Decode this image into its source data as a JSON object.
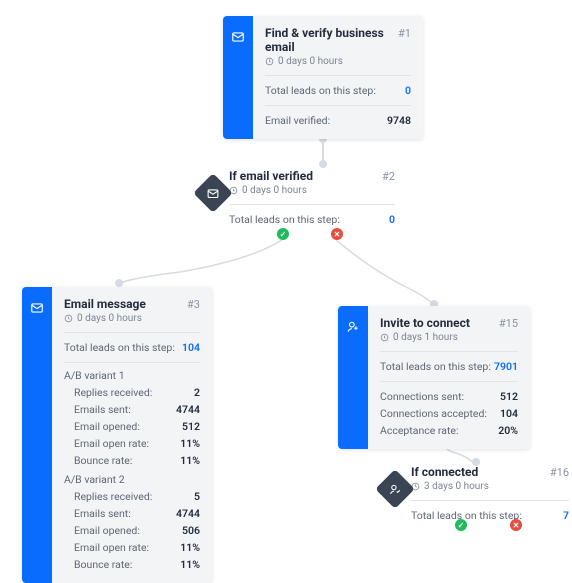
{
  "nodes": {
    "n1": {
      "title": "Find & verify business email",
      "step": "#1",
      "delay": "0 days 0 hours",
      "rows": [
        {
          "lbl": "Total leads on this step:",
          "val": "0",
          "blue": true
        },
        {
          "lbl": "Email verified:",
          "val": "9748"
        }
      ]
    },
    "n2": {
      "title": "If email verified",
      "step": "#2",
      "delay": "0 days 0 hours",
      "rows": [
        {
          "lbl": "Total leads on this step:",
          "val": "0",
          "blue": true
        }
      ]
    },
    "n3": {
      "title": "Email message",
      "step": "#3",
      "delay": "0 days 0 hours",
      "lead_row": {
        "lbl": "Total leads on this step:",
        "val": "104",
        "blue": true
      },
      "v1_label": "A/B variant 1",
      "v1_rows": [
        {
          "lbl": "Replies received:",
          "val": "2"
        },
        {
          "lbl": "Emails sent:",
          "val": "4744"
        },
        {
          "lbl": "Email opened:",
          "val": "512"
        },
        {
          "lbl": "Email open rate:",
          "val": "11%"
        },
        {
          "lbl": "Bounce rate:",
          "val": "11%"
        }
      ],
      "v2_label": "A/B variant 2",
      "v2_rows": [
        {
          "lbl": "Replies received:",
          "val": "5"
        },
        {
          "lbl": "Emails sent:",
          "val": "4744"
        },
        {
          "lbl": "Email opened:",
          "val": "506"
        },
        {
          "lbl": "Email open rate:",
          "val": "11%"
        },
        {
          "lbl": "Bounce rate:",
          "val": "11%"
        }
      ]
    },
    "n15": {
      "title": "Invite to connect",
      "step": "#15",
      "delay": "0 days 1 hours",
      "rows": [
        {
          "lbl": "Total leads on this step:",
          "val": "7901",
          "blue": true
        },
        {
          "lbl": "Connections sent:",
          "val": "512"
        },
        {
          "lbl": "Connections accepted:",
          "val": "104"
        },
        {
          "lbl": "Acceptance rate:",
          "val": "20%"
        }
      ]
    },
    "n16": {
      "title": "If connected",
      "step": "#16",
      "delay": "3 days 0 hours",
      "rows": [
        {
          "lbl": "Total leads on this step:",
          "val": "7",
          "blue": true
        }
      ]
    }
  }
}
